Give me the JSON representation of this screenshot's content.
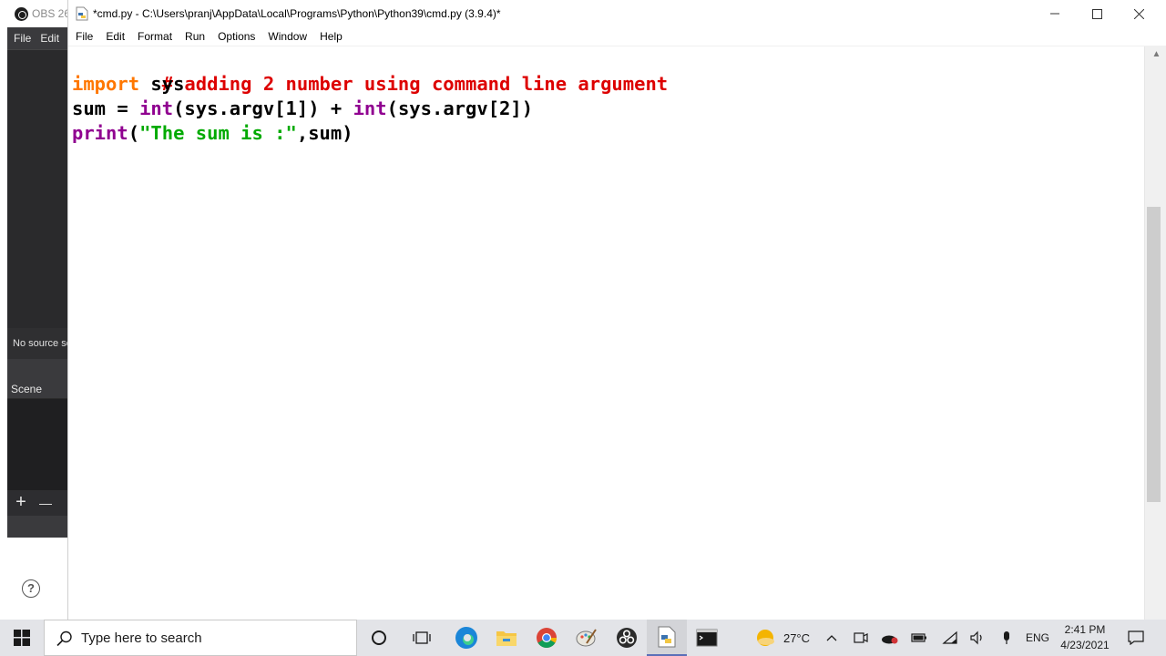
{
  "obs": {
    "title": "OBS 26",
    "menu": [
      "File",
      "Edit"
    ],
    "no_source_text": "No source se",
    "scene_header": "Scene",
    "scene_add": "+",
    "scene_remove": "—",
    "help_glyph": "?"
  },
  "idle": {
    "title": "*cmd.py - C:\\Users\\pranj\\AppData\\Local\\Programs\\Python\\Python39\\cmd.py (3.9.4)*",
    "window_controls": {
      "minimize": "—",
      "maximize": "☐",
      "close": "✕"
    },
    "menu": [
      "File",
      "Edit",
      "Format",
      "Run",
      "Options",
      "Window",
      "Help"
    ],
    "code": {
      "line1": {
        "comment": "# adding 2 number using command line argument"
      },
      "line2": {
        "keyword": "import",
        "rest": " sys"
      },
      "line3": {
        "a": "sum = ",
        "b": "int",
        "c": "(sys.argv[1]) + ",
        "d": "int",
        "e": "(sys.argv[2])"
      },
      "line4": {
        "a": "print",
        "b": "(",
        "c": "\"The sum is :\"",
        "d": ",sum)"
      }
    },
    "colors": {
      "comment": "#dd0000",
      "keyword": "#ff7700",
      "builtin": "#900090",
      "string": "#00aa00"
    }
  },
  "taskbar": {
    "search_placeholder": "Type here to search",
    "pinned": [
      "cortana-icon",
      "task-view-icon",
      "edge-icon",
      "file-explorer-icon",
      "chrome-icon",
      "paint-icon",
      "obs-icon",
      "python-idle-icon",
      "terminal-icon"
    ],
    "weather": "27°C",
    "language": "ENG",
    "time": "2:41 PM",
    "date": "4/23/2021"
  }
}
